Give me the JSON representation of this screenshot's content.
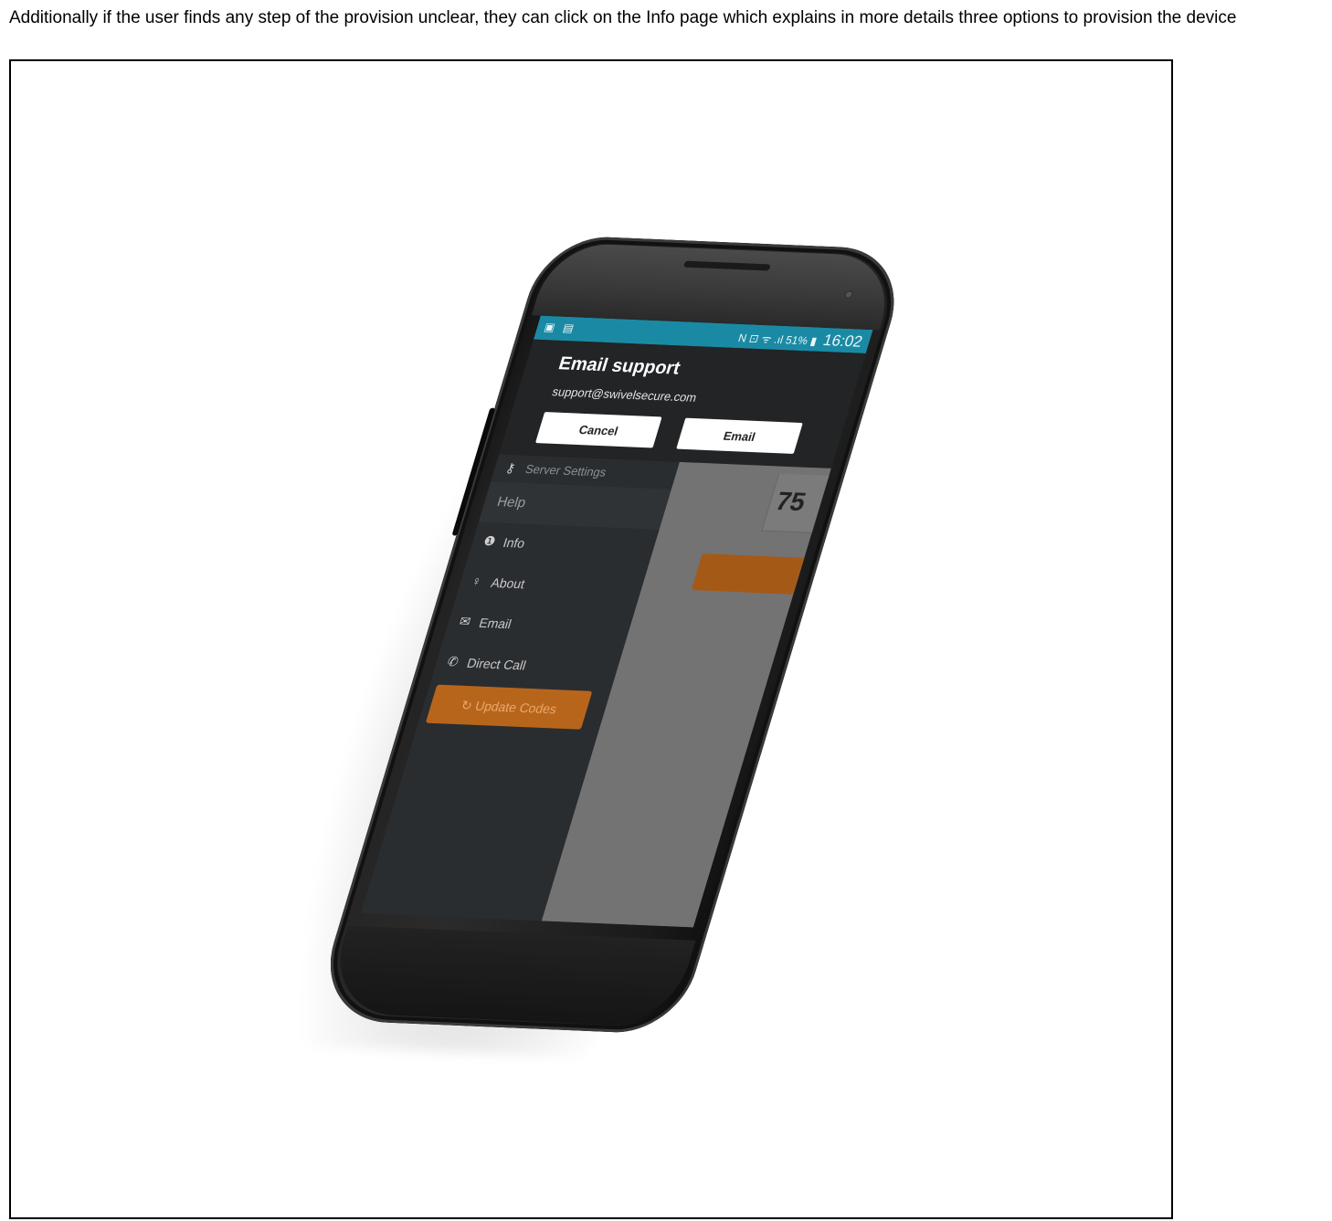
{
  "caption": "Additionally if the user finds any step of the provision unclear, they can click on the Info page which explains in more details three options to provision the device",
  "phone": {
    "status_bar": {
      "left_icons": "▣ ▤",
      "right_icons": "N ⊡ ᯤ .ıl 51% ▮",
      "time": "16:02",
      "color": "#1a8aa4"
    },
    "dialog": {
      "title": "Email support",
      "email": "support@swivelsecure.com",
      "cancel_label": "Cancel",
      "email_label": "Email"
    },
    "drawer": {
      "server_settings": "Server Settings",
      "help_header": "Help",
      "items": [
        {
          "icon": "info-icon",
          "glyph": "❶",
          "label": "Info"
        },
        {
          "icon": "lightbulb-icon",
          "glyph": "♀",
          "label": "About"
        },
        {
          "icon": "mail-icon",
          "glyph": "✉",
          "label": "Email"
        },
        {
          "icon": "phone-icon",
          "glyph": "✆",
          "label": "Direct Call"
        }
      ],
      "update_label": "↻ Update Codes",
      "update_color": "#b8651c"
    },
    "content": {
      "code_value": "75"
    }
  }
}
